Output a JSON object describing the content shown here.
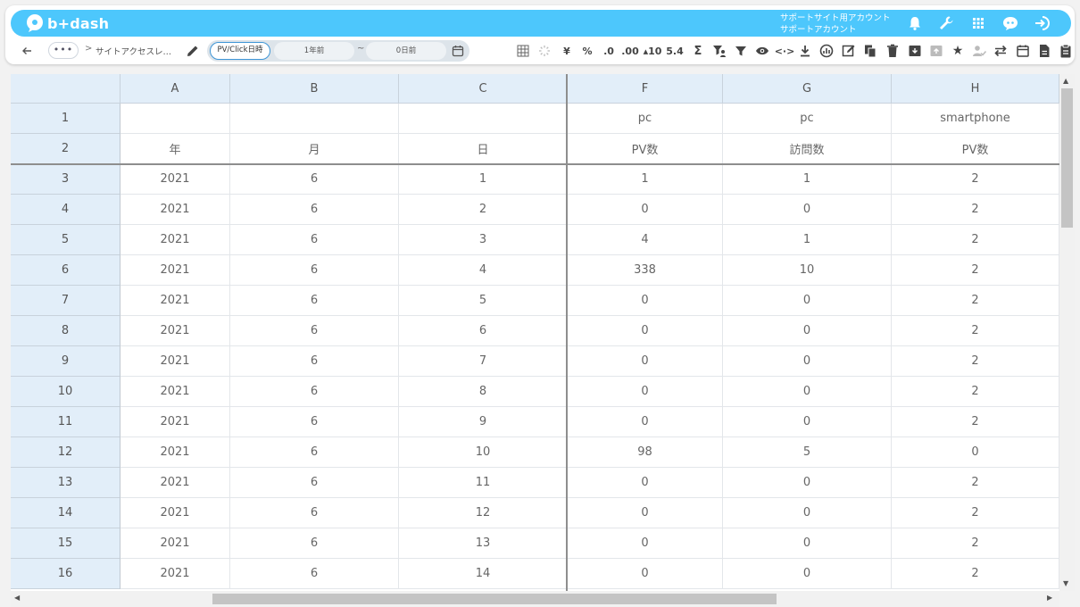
{
  "app": {
    "logo_text": "b+dash",
    "account_line1": "サポートサイト用アカウント",
    "account_line2": "サポートアカウント"
  },
  "topbar_icons": [
    "bell-icon",
    "wrench-icon",
    "apps-grid-icon",
    "chat-bot-icon",
    "logout-icon"
  ],
  "subbar": {
    "more_label": "•••",
    "breadcrumb_sep": ">",
    "breadcrumb": "サイトアクセスレ…",
    "date_range": {
      "type_label": "PV/Click日時",
      "from": "1年前",
      "tilde": "~",
      "to": "0日前"
    }
  },
  "toolbar": [
    {
      "name": "table-layout-icon",
      "text": ""
    },
    {
      "name": "loading-icon",
      "text": ""
    },
    {
      "name": "yen-format-button",
      "text": "¥"
    },
    {
      "name": "percent-format-button",
      "text": "%"
    },
    {
      "name": "decimal-decrease-button",
      "text": ".0"
    },
    {
      "name": "decimal-increase-button",
      "text": ".00"
    },
    {
      "name": "sort-asc-button",
      "text": "▴10"
    },
    {
      "name": "round-number-button",
      "text": "5.4"
    },
    {
      "name": "sum-icon",
      "text": "Σ"
    },
    {
      "name": "filter-user-icon",
      "text": ""
    },
    {
      "name": "filter-icon",
      "text": ""
    },
    {
      "name": "eye-icon",
      "text": ""
    },
    {
      "name": "code-icon",
      "text": "<·>"
    },
    {
      "name": "download-icon",
      "text": ""
    },
    {
      "name": "chart-icon",
      "text": ""
    },
    {
      "name": "edit-note-icon",
      "text": ""
    },
    {
      "name": "copy-icon",
      "text": ""
    },
    {
      "name": "trash-icon",
      "text": ""
    },
    {
      "name": "archive-icon",
      "text": ""
    },
    {
      "name": "archive-disabled-icon",
      "text": ""
    },
    {
      "name": "star-icon",
      "text": "★"
    },
    {
      "name": "user-check-icon",
      "text": ""
    },
    {
      "name": "swap-icon",
      "text": ""
    },
    {
      "name": "calendar-icon",
      "text": ""
    },
    {
      "name": "document-icon",
      "text": ""
    },
    {
      "name": "clipboard-icon",
      "text": ""
    }
  ],
  "sheet": {
    "columns": [
      "A",
      "B",
      "C",
      "F",
      "G",
      "H"
    ],
    "header_rows": [
      {
        "row": "1",
        "cells": [
          "",
          "",
          "",
          "pc",
          "pc",
          "smartphone"
        ]
      },
      {
        "row": "2",
        "cells": [
          "年",
          "月",
          "日",
          "PV数",
          "訪問数",
          "PV数"
        ]
      }
    ],
    "rows": [
      {
        "row": "3",
        "cells": [
          "2021",
          "6",
          "1",
          "1",
          "1",
          "2"
        ]
      },
      {
        "row": "4",
        "cells": [
          "2021",
          "6",
          "2",
          "0",
          "0",
          "2"
        ]
      },
      {
        "row": "5",
        "cells": [
          "2021",
          "6",
          "3",
          "4",
          "1",
          "2"
        ]
      },
      {
        "row": "6",
        "cells": [
          "2021",
          "6",
          "4",
          "338",
          "10",
          "2"
        ]
      },
      {
        "row": "7",
        "cells": [
          "2021",
          "6",
          "5",
          "0",
          "0",
          "2"
        ]
      },
      {
        "row": "8",
        "cells": [
          "2021",
          "6",
          "6",
          "0",
          "0",
          "2"
        ]
      },
      {
        "row": "9",
        "cells": [
          "2021",
          "6",
          "7",
          "0",
          "0",
          "2"
        ]
      },
      {
        "row": "10",
        "cells": [
          "2021",
          "6",
          "8",
          "0",
          "0",
          "2"
        ]
      },
      {
        "row": "11",
        "cells": [
          "2021",
          "6",
          "9",
          "0",
          "0",
          "2"
        ]
      },
      {
        "row": "12",
        "cells": [
          "2021",
          "6",
          "10",
          "98",
          "5",
          "0"
        ]
      },
      {
        "row": "13",
        "cells": [
          "2021",
          "6",
          "11",
          "0",
          "0",
          "2"
        ]
      },
      {
        "row": "14",
        "cells": [
          "2021",
          "6",
          "12",
          "0",
          "0",
          "2"
        ]
      },
      {
        "row": "15",
        "cells": [
          "2021",
          "6",
          "13",
          "0",
          "0",
          "2"
        ]
      },
      {
        "row": "16",
        "cells": [
          "2021",
          "6",
          "14",
          "0",
          "0",
          "2"
        ]
      }
    ]
  },
  "scroll": {
    "vertical_up": "▲",
    "vertical_down": "▼",
    "horizontal_left": "◀",
    "horizontal_right": "▶"
  },
  "colors": {
    "brand": "#4dc7fc",
    "header_fill": "#e2eef9",
    "accent_border": "#3d95d6"
  }
}
